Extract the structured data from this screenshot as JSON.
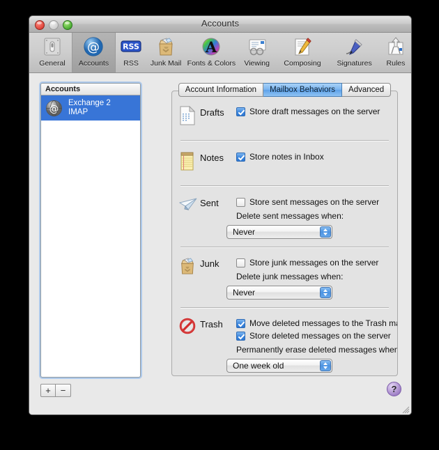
{
  "window": {
    "title": "Accounts",
    "controls": {
      "close": "close-button",
      "minimize": "minimize-button",
      "zoom": "zoom-button"
    }
  },
  "toolbar": {
    "items": [
      {
        "label": "General",
        "icon": "general-icon"
      },
      {
        "label": "Accounts",
        "icon": "accounts-icon",
        "selected": true
      },
      {
        "label": "RSS",
        "icon": "rss-icon"
      },
      {
        "label": "Junk Mail",
        "icon": "junk-mail-icon"
      },
      {
        "label": "Fonts & Colors",
        "icon": "fonts-colors-icon"
      },
      {
        "label": "Viewing",
        "icon": "viewing-icon"
      },
      {
        "label": "Composing",
        "icon": "composing-icon"
      },
      {
        "label": "Signatures",
        "icon": "signatures-icon"
      },
      {
        "label": "Rules",
        "icon": "rules-icon"
      }
    ]
  },
  "sidebar": {
    "header": "Accounts",
    "accounts": [
      {
        "name": "Exchange 2",
        "type": "IMAP",
        "selected": true
      }
    ],
    "add_label": "+",
    "remove_label": "−"
  },
  "tabs": [
    {
      "label": "Account Information",
      "active": false
    },
    {
      "label": "Mailbox Behaviors",
      "active": true
    },
    {
      "label": "Advanced",
      "active": false
    }
  ],
  "sections": {
    "drafts": {
      "title": "Drafts",
      "icon": "drafts-document-icon",
      "checkbox_label": "Store draft messages on the server",
      "checked": true
    },
    "notes": {
      "title": "Notes",
      "icon": "notes-pad-icon",
      "checkbox_label": "Store notes in Inbox",
      "checked": true
    },
    "sent": {
      "title": "Sent",
      "icon": "sent-paper-plane-icon",
      "checkbox_label": "Store sent messages on the server",
      "checked": false,
      "when_label": "Delete sent messages when:",
      "popup_value": "Never"
    },
    "junk": {
      "title": "Junk",
      "icon": "junk-bag-icon",
      "checkbox_label": "Store junk messages on the server",
      "checked": false,
      "when_label": "Delete junk messages when:",
      "popup_value": "Never"
    },
    "trash": {
      "title": "Trash",
      "icon": "trash-no-entry-icon",
      "checkbox1_label": "Move deleted messages to the Trash mailbox",
      "checked1": true,
      "checkbox2_label": "Store deleted messages on the server",
      "checked2": true,
      "when_label": "Permanently erase deleted messages when:",
      "popup_value": "One week old"
    }
  },
  "help": {
    "label": "?"
  },
  "colors": {
    "selection_blue": "#3875d7",
    "active_tab_blue": "#7ab4ef",
    "checkbox_blue": "#3a85dd",
    "window_bg": "#e8e8e8",
    "panel_bg": "#e3e3e3",
    "help_purple": "#a98ccd"
  }
}
